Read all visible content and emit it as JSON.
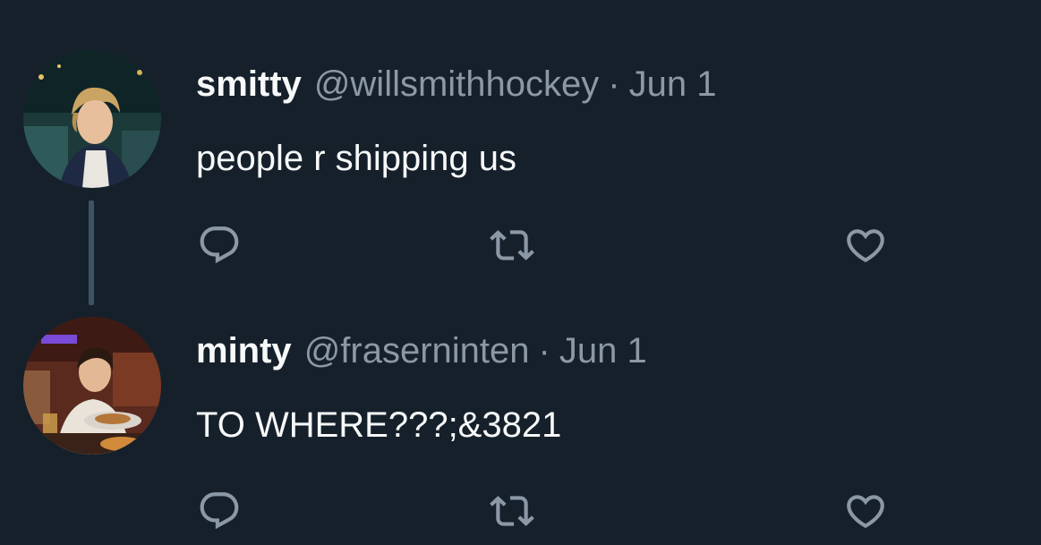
{
  "tweets": [
    {
      "author_name": "smitty",
      "handle": "@willsmithhockey",
      "separator": "·",
      "date": "Jun 1",
      "text": "people r shipping us"
    },
    {
      "author_name": "minty",
      "handle": "@fraserninten",
      "separator": "·",
      "date": "Jun 1",
      "text": "TO WHERE???;&3821"
    }
  ],
  "icons": {
    "reply": "reply-icon",
    "retweet": "retweet-icon",
    "like": "heart-icon"
  },
  "colors": {
    "background": "#15202b",
    "primary_text": "#f7f9f9",
    "secondary_text": "#8b98a5",
    "thread_line": "#3d5466"
  }
}
